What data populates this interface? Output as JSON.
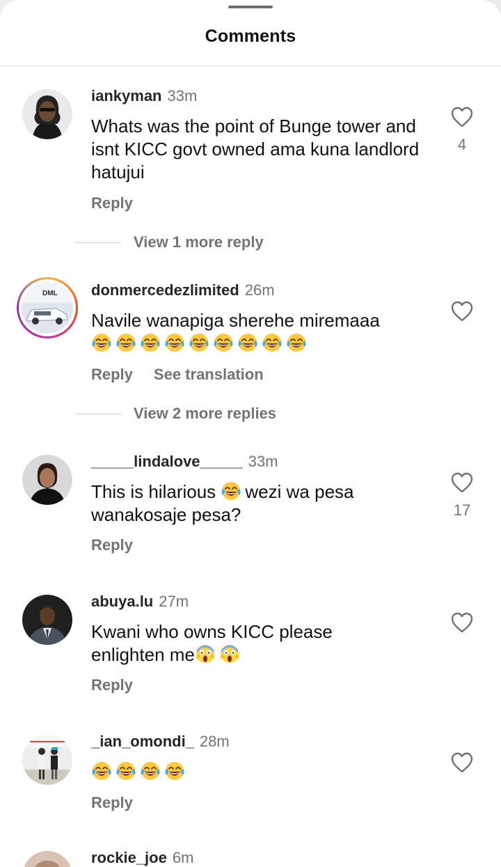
{
  "header": {
    "title": "Comments"
  },
  "comments": [
    {
      "username": "iankyman",
      "time": "33m",
      "text": "Whats was the point of Bunge tower and isnt KICC govt owned ama kuna landlord hatujui",
      "reply_label": "Reply",
      "likes": "4",
      "view_replies": "View 1 more reply",
      "avatar_icon": "man-with-dreadlocks-avatar"
    },
    {
      "username": "donmercedezlimited",
      "time": "26m",
      "text": "Navile wanapiga sherehe miremaaa",
      "emojis": [
        "😂",
        "😂",
        "😂",
        "😂",
        "😂",
        "😂",
        "😂",
        "😂",
        "😂"
      ],
      "reply_label": "Reply",
      "translate_label": "See translation",
      "view_replies": "View 2 more replies",
      "avatar_logo_text": "DML",
      "avatar_icon": "white-suv-showroom-avatar"
    },
    {
      "username": "_____lindalove_____",
      "time": "33m",
      "text_before": "This is hilarious ",
      "emoji": "😂",
      "text_after": "wezi wa pesa wanakosaje pesa?",
      "reply_label": "Reply",
      "likes": "17",
      "avatar_icon": "woman-portrait-avatar"
    },
    {
      "username": "abuya.lu",
      "time": "27m",
      "text": "Kwani who owns KICC please enlighten me",
      "emojis": [
        "😱",
        "😱"
      ],
      "reply_label": "Reply",
      "avatar_icon": "man-in-suit-avatar"
    },
    {
      "username": "_ian_omondi_",
      "time": "28m",
      "emojis": [
        "😂",
        "😂",
        "😂",
        "😂"
      ],
      "reply_label": "Reply",
      "avatar_icon": "two-people-outdoor-avatar"
    },
    {
      "username": "rockie_joe",
      "time": "6m",
      "avatar_icon": "partial-avatar"
    }
  ],
  "colors": {
    "text": "#111111",
    "muted": "#737373",
    "story_ring": "#d6249f"
  },
  "icons": {
    "like": "heart-outline-icon",
    "laugh": "face-with-tears-of-joy-emoji",
    "scream": "face-screaming-in-fear-emoji"
  }
}
